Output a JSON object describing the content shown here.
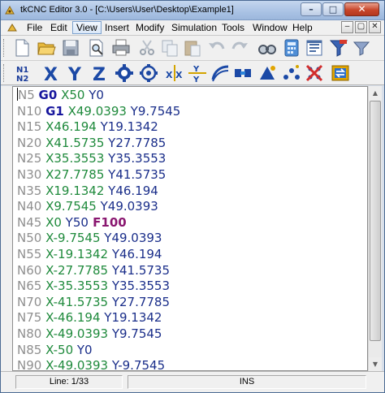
{
  "window": {
    "title": "tkCNC Editor 3.0 - [C:\\Users\\User\\Desktop\\Example1]",
    "minimize_glyph": "–",
    "maximize_glyph": "□",
    "close_glyph": "✕"
  },
  "menubar": {
    "items": [
      "File",
      "Edit",
      "View",
      "Insert",
      "Modify",
      "Simulation",
      "Tools",
      "Window",
      "Help"
    ],
    "active": "View",
    "mdi_minimize_glyph": "–",
    "mdi_restore_glyph": "▢",
    "mdi_close_glyph": "✕"
  },
  "toolbar_top": {
    "icons": [
      "new-file-icon",
      "open-folder-icon",
      "save-icon",
      "print-preview-icon",
      "print-icon",
      "cut-icon",
      "copy-icon",
      "paste-icon",
      "undo-icon",
      "redo-icon",
      "find-icon",
      "calculator-icon",
      "properties-icon",
      "filter-icon",
      "filter-settings-icon"
    ]
  },
  "toolbar_bottom": {
    "n1n2_label": [
      "N1",
      "N2"
    ],
    "x_label": "X",
    "y_label": "Y",
    "z_label": "Z",
    "icons": [
      "gear-icon",
      "gear-outline-icon",
      "mirror-x-icon",
      "mirror-y-icon",
      "arc-icon",
      "connect-icon",
      "tool-path-icon",
      "points-icon",
      "delete-points-icon",
      "swap-icon"
    ]
  },
  "editor": {
    "lines": [
      [
        {
          "t": "N5 ",
          "c": "n"
        },
        {
          "t": "G0",
          "c": "g"
        },
        {
          "t": " X50",
          "c": "x"
        },
        {
          "t": " Y0",
          "c": "y"
        }
      ],
      [
        {
          "t": "N10 ",
          "c": "n"
        },
        {
          "t": "G1",
          "c": "g"
        },
        {
          "t": " X49.0393",
          "c": "x"
        },
        {
          "t": " Y9.7545",
          "c": "y"
        }
      ],
      [
        {
          "t": "N15 ",
          "c": "n"
        },
        {
          "t": "X46.194",
          "c": "x"
        },
        {
          "t": " Y19.1342",
          "c": "y"
        }
      ],
      [
        {
          "t": "N20 ",
          "c": "n"
        },
        {
          "t": "X41.5735",
          "c": "x"
        },
        {
          "t": " Y27.7785",
          "c": "y"
        }
      ],
      [
        {
          "t": "N25 ",
          "c": "n"
        },
        {
          "t": "X35.3553",
          "c": "x"
        },
        {
          "t": " Y35.3553",
          "c": "y"
        }
      ],
      [
        {
          "t": "N30 ",
          "c": "n"
        },
        {
          "t": "X27.7785",
          "c": "x"
        },
        {
          "t": " Y41.5735",
          "c": "y"
        }
      ],
      [
        {
          "t": "N35 ",
          "c": "n"
        },
        {
          "t": "X19.1342",
          "c": "x"
        },
        {
          "t": " Y46.194",
          "c": "y"
        }
      ],
      [
        {
          "t": "N40 ",
          "c": "n"
        },
        {
          "t": "X9.7545",
          "c": "x"
        },
        {
          "t": " Y49.0393",
          "c": "y"
        }
      ],
      [
        {
          "t": "N45 ",
          "c": "n"
        },
        {
          "t": "X0",
          "c": "x"
        },
        {
          "t": " Y50",
          "c": "y"
        },
        {
          "t": " F100",
          "c": "f"
        }
      ],
      [
        {
          "t": "N50 ",
          "c": "n"
        },
        {
          "t": "X-9.7545",
          "c": "x"
        },
        {
          "t": " Y49.0393",
          "c": "y"
        }
      ],
      [
        {
          "t": "N55 ",
          "c": "n"
        },
        {
          "t": "X-19.1342",
          "c": "x"
        },
        {
          "t": " Y46.194",
          "c": "y"
        }
      ],
      [
        {
          "t": "N60 ",
          "c": "n"
        },
        {
          "t": "X-27.7785",
          "c": "x"
        },
        {
          "t": " Y41.5735",
          "c": "y"
        }
      ],
      [
        {
          "t": "N65 ",
          "c": "n"
        },
        {
          "t": "X-35.3553",
          "c": "x"
        },
        {
          "t": " Y35.3553",
          "c": "y"
        }
      ],
      [
        {
          "t": "N70 ",
          "c": "n"
        },
        {
          "t": "X-41.5735",
          "c": "x"
        },
        {
          "t": " Y27.7785",
          "c": "y"
        }
      ],
      [
        {
          "t": "N75 ",
          "c": "n"
        },
        {
          "t": "X-46.194",
          "c": "x"
        },
        {
          "t": " Y19.1342",
          "c": "y"
        }
      ],
      [
        {
          "t": "N80 ",
          "c": "n"
        },
        {
          "t": "X-49.0393",
          "c": "x"
        },
        {
          "t": " Y9.7545",
          "c": "y"
        }
      ],
      [
        {
          "t": "N85 ",
          "c": "n"
        },
        {
          "t": "X-50",
          "c": "x"
        },
        {
          "t": " Y0",
          "c": "y"
        }
      ],
      [
        {
          "t": "N90 ",
          "c": "n"
        },
        {
          "t": "X-49.0393",
          "c": "x"
        },
        {
          "t": " Y-9.7545",
          "c": "y"
        }
      ]
    ]
  },
  "statusbar": {
    "line": "Line: 1/33",
    "mode": "INS"
  },
  "colors": {
    "line_number": "#8f8f8f",
    "g_code": "#17169d",
    "x_coord": "#1f8a3c",
    "y_coord": "#1a2e8a",
    "feed": "#8a1770"
  }
}
